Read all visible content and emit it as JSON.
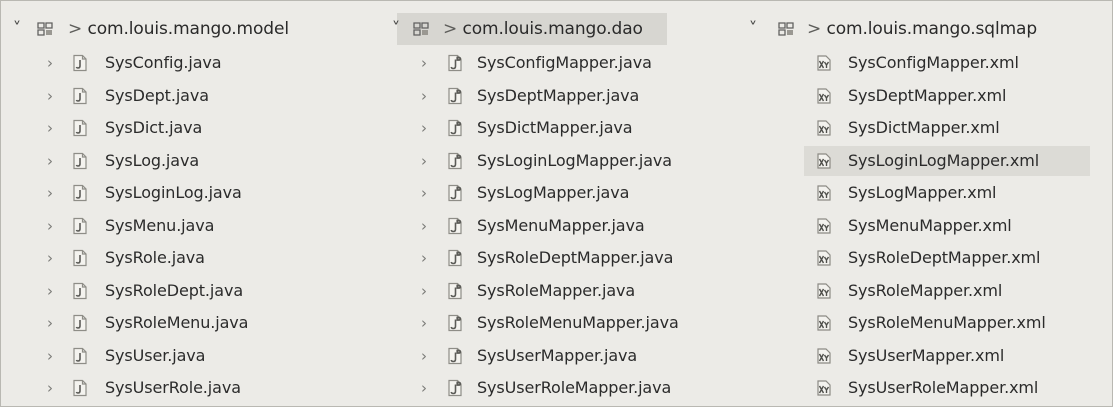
{
  "columns": [
    {
      "package": {
        "prefix": ">",
        "name": "com.louis.mango.model",
        "expanded_glyph": "˅"
      },
      "files": [
        {
          "name": "SysConfig.java"
        },
        {
          "name": "SysDept.java"
        },
        {
          "name": "SysDict.java"
        },
        {
          "name": "SysLog.java"
        },
        {
          "name": "SysLoginLog.java"
        },
        {
          "name": "SysMenu.java"
        },
        {
          "name": "SysRole.java"
        },
        {
          "name": "SysRoleDept.java"
        },
        {
          "name": "SysRoleMenu.java"
        },
        {
          "name": "SysUser.java"
        },
        {
          "name": "SysUserRole.java"
        }
      ]
    },
    {
      "package": {
        "prefix": ">",
        "name": "com.louis.mango.dao",
        "expanded_glyph": "˅"
      },
      "files": [
        {
          "name": "SysConfigMapper.java"
        },
        {
          "name": "SysDeptMapper.java"
        },
        {
          "name": "SysDictMapper.java"
        },
        {
          "name": "SysLoginLogMapper.java"
        },
        {
          "name": "SysLogMapper.java"
        },
        {
          "name": "SysMenuMapper.java"
        },
        {
          "name": "SysRoleDeptMapper.java"
        },
        {
          "name": "SysRoleMapper.java"
        },
        {
          "name": "SysRoleMenuMapper.java"
        },
        {
          "name": "SysUserMapper.java"
        },
        {
          "name": "SysUserRoleMapper.java"
        }
      ]
    },
    {
      "package": {
        "prefix": ">",
        "name": "com.louis.mango.sqlmap",
        "expanded_glyph": "˅"
      },
      "files": [
        {
          "name": "SysConfigMapper.xml"
        },
        {
          "name": "SysDeptMapper.xml"
        },
        {
          "name": "SysDictMapper.xml"
        },
        {
          "name": "SysLoginLogMapper.xml"
        },
        {
          "name": "SysLogMapper.xml"
        },
        {
          "name": "SysMenuMapper.xml"
        },
        {
          "name": "SysRoleDeptMapper.xml"
        },
        {
          "name": "SysRoleMapper.xml"
        },
        {
          "name": "SysRoleMenuMapper.xml"
        },
        {
          "name": "SysUserMapper.xml"
        },
        {
          "name": "SysUserRoleMapper.xml"
        }
      ]
    }
  ],
  "icons": {
    "expanded": "chevron-down-icon",
    "collapsed": "chevron-right-icon",
    "package": "package-icon",
    "java_file": "java-file-icon",
    "xml_file": "xml-file-icon"
  },
  "colors": {
    "background": "#ecebe7",
    "selected_package": "#d7d6d1",
    "hover_file": "#dcdbd6",
    "text": "#2a2a2a"
  }
}
